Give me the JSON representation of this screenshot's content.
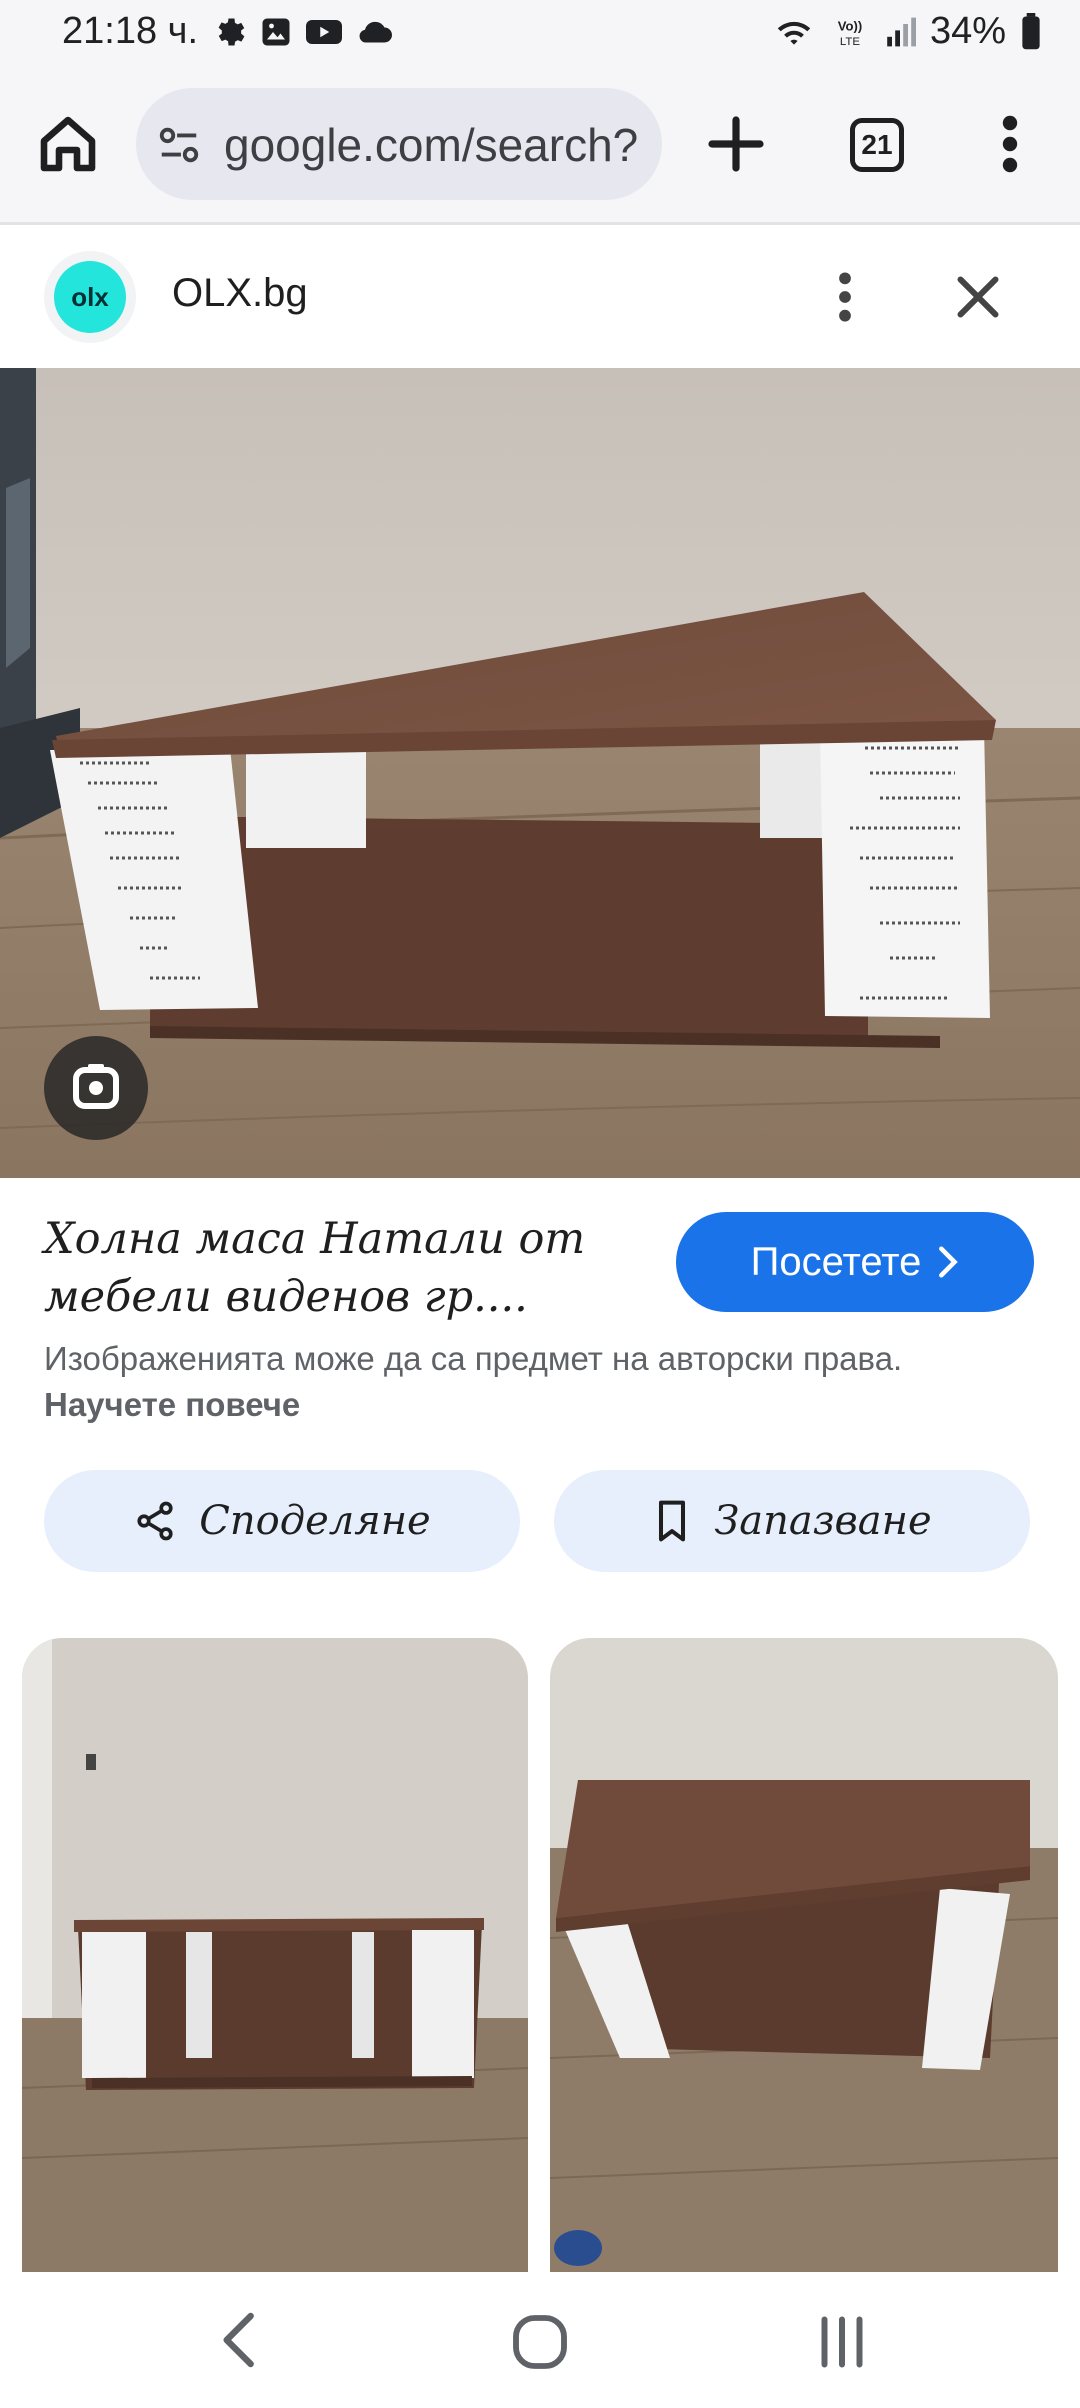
{
  "status_bar": {
    "time": "21:18 ч.",
    "icons_left": [
      "gear-icon",
      "image-icon",
      "youtube-icon",
      "cloud-icon"
    ],
    "icons_right": [
      "wifi-icon",
      "volte-icon",
      "signal-icon",
      "battery-icon"
    ],
    "battery": "34%"
  },
  "browser": {
    "url": "google.com/search?",
    "tab_count": "21"
  },
  "source": {
    "logo_text": "olx",
    "name": "OLX.bg"
  },
  "result": {
    "title": "Холна маса Натали от мебели виденов гр....",
    "visit_label": "Посетете",
    "copyright_text": "Изображенията може да са предмет на авторски права.",
    "learn_more": "Научете повече"
  },
  "actions": {
    "share_label": "Споделяне",
    "save_label": "Запазване"
  },
  "colors": {
    "accent": "#1a73e8",
    "chip_bg": "#e8effc",
    "olx_teal": "#23e5db",
    "wood": "#6b4434"
  }
}
